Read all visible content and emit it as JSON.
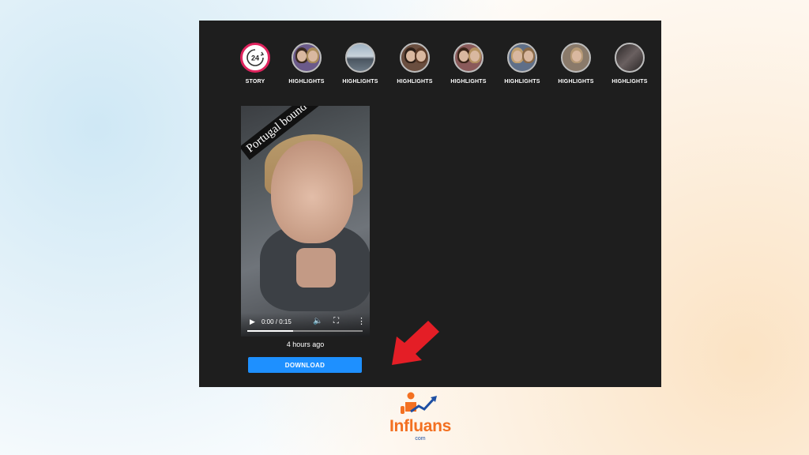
{
  "stories": [
    {
      "label": "STORY",
      "kind": "story",
      "badge": "24"
    },
    {
      "label": "HIGHLIGHTS",
      "kind": "highlight",
      "tone": "#6b5a8a"
    },
    {
      "label": "HIGHLIGHTS",
      "kind": "highlight",
      "tone": "#7f95a8"
    },
    {
      "label": "HIGHLIGHTS",
      "kind": "highlight",
      "tone": "#6a4e3f"
    },
    {
      "label": "HIGHLIGHTS",
      "kind": "highlight",
      "tone": "#8a5a5a"
    },
    {
      "label": "HIGHLIGHTS",
      "kind": "highlight",
      "tone": "#5f6f88"
    },
    {
      "label": "HIGHLIGHTS",
      "kind": "highlight",
      "tone": "#8a7a6a"
    },
    {
      "label": "HIGHLIGHTS",
      "kind": "highlight",
      "tone": "#3f3a3a"
    }
  ],
  "video": {
    "caption": "Portugal bound !",
    "time": "0:00 / 0:15",
    "progress": 0.4
  },
  "post": {
    "time_ago": "4 hours ago",
    "download_label": "DOWNLOAD"
  },
  "brand": {
    "name": "Influans",
    "domain": "com",
    "color_primary": "#f37021",
    "color_secondary": "#1e4fa3"
  },
  "colors": {
    "panel_bg": "#1e1e1e",
    "button_bg": "#1e90ff",
    "arrow": "#e41e26",
    "story_ring": "#e0245e"
  }
}
